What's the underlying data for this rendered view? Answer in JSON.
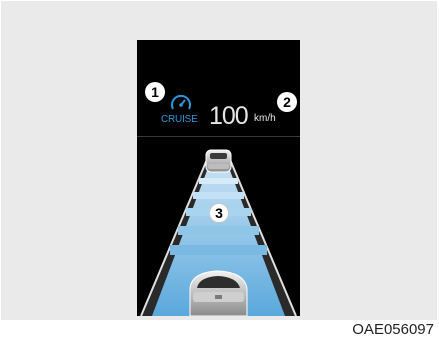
{
  "display": {
    "cruise_label": "CRUISE",
    "set_speed": "100",
    "speed_unit": "km/h"
  },
  "callouts": {
    "one": "1",
    "two": "2",
    "three": "3"
  },
  "figure_code": "OAE056097",
  "icons": {
    "cruise": "cruise-speedometer-icon",
    "lead_vehicle": "car-front-icon",
    "own_vehicle": "car-rear-icon"
  },
  "colors": {
    "cruise_indicator": "#2b95d6",
    "lane": "#8fc6e8",
    "background": "#000000"
  }
}
